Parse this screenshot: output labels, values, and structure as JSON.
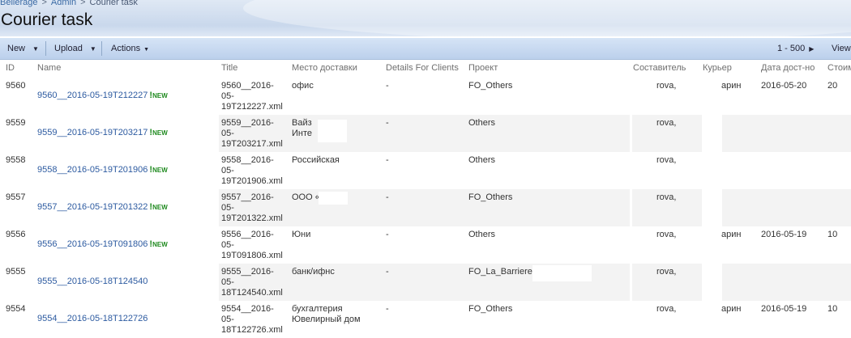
{
  "breadcrumb": {
    "site": "Bellerage",
    "sep": ">",
    "section": "Admin",
    "current": "Courier task"
  },
  "page_title": "Courier task",
  "toolbar": {
    "new_label": "New",
    "upload_label": "Upload",
    "actions_label": "Actions",
    "paging": "1 - 500",
    "view_label": "View"
  },
  "columns": {
    "id": "ID",
    "name": "Name",
    "title": "Title",
    "delivery_place": "Место доставки",
    "details": "Details For Clients",
    "project": "Проект",
    "author": "Составитель",
    "courier": "Курьер",
    "delivery_date": "Дата дост-но",
    "cost": "Стоим"
  },
  "new_label": "NEW",
  "rows": [
    {
      "id": "9560",
      "name": "9560__2016-05-19T212227",
      "is_new": true,
      "title": [
        "9560__2016-",
        "05-",
        "19T212227.xml"
      ],
      "place": [
        "офис"
      ],
      "details": "-",
      "project": "FO_Others",
      "author": "rova,",
      "courier": "арин",
      "date": "2016-05-20",
      "cost": "20"
    },
    {
      "id": "9559",
      "name": "9559__2016-05-19T203217",
      "is_new": true,
      "title": [
        "9559__2016-",
        "05-",
        "19T203217.xml"
      ],
      "place": [
        "Вайз",
        "Инте"
      ],
      "details": "-",
      "project": "Others",
      "author": "rova,",
      "courier": "",
      "date": "",
      "cost": ""
    },
    {
      "id": "9558",
      "name": "9558__2016-05-19T201906",
      "is_new": true,
      "title": [
        "9558__2016-",
        "05-",
        "19T201906.xml"
      ],
      "place": [
        "Российская"
      ],
      "details": "-",
      "project": "Others",
      "author": "rova,",
      "courier": "",
      "date": "",
      "cost": ""
    },
    {
      "id": "9557",
      "name": "9557__2016-05-19T201322",
      "is_new": true,
      "title": [
        "9557__2016-",
        "05-",
        "19T201322.xml"
      ],
      "place": [
        "ООО «"
      ],
      "details": "-",
      "project": "FO_Others",
      "author": "rova,",
      "courier": "",
      "date": "",
      "cost": ""
    },
    {
      "id": "9556",
      "name": "9556__2016-05-19T091806",
      "is_new": true,
      "title": [
        "9556__2016-",
        "05-",
        "19T091806.xml"
      ],
      "place": [
        "Юни"
      ],
      "details": "-",
      "project": "Others",
      "author": "rova,",
      "courier": "арин",
      "date": "2016-05-19",
      "cost": "10"
    },
    {
      "id": "9555",
      "name": "9555__2016-05-18T124540",
      "is_new": false,
      "title": [
        "9555__2016-",
        "05-",
        "18T124540.xml"
      ],
      "place": [
        "банк/ифнс"
      ],
      "details": "-",
      "project": "FO_La_Barriere",
      "author": "rova,",
      "courier": "",
      "date": "",
      "cost": ""
    },
    {
      "id": "9554",
      "name": "9554__2016-05-18T122726",
      "is_new": false,
      "title": [
        "9554__2016-",
        "05-",
        "18T122726.xml"
      ],
      "place": [
        "бухгалтерия",
        "Ювелирный дом"
      ],
      "details": "-",
      "project": "FO_Others",
      "author": "rova,",
      "courier": "арин",
      "date": "2016-05-19",
      "cost": "10"
    }
  ]
}
